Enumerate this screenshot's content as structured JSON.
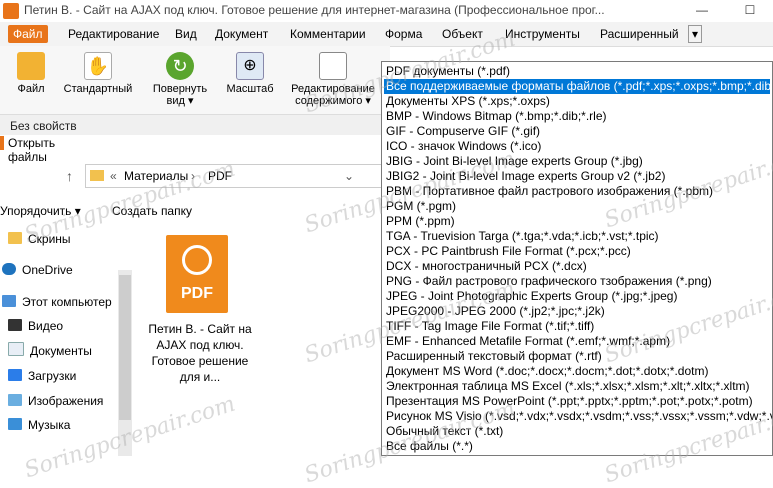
{
  "window": {
    "title": "Петин В. - Сайт на AJAX под ключ. Готовое решение для интернет-магазина (Профессиональное прог...",
    "minimize": "—",
    "maximize": "☐"
  },
  "menu": [
    "Файл",
    "Редактирование",
    "Вид",
    "Документ",
    "Комментарии",
    "Форма",
    "Объект",
    "Инструменты",
    "Расширенный"
  ],
  "menu_more": "▾",
  "ribbon": [
    {
      "line1": "Файл",
      "line2": ""
    },
    {
      "line1": "Стандартный",
      "line2": ""
    },
    {
      "line1": "Повернуть",
      "line2": "вид ▾"
    },
    {
      "line1": "Масштаб",
      "line2": ""
    },
    {
      "line1": "Редактирование",
      "line2": "содержимого ▾"
    }
  ],
  "properties": "Без свойств",
  "dialog": {
    "title": "Открыть файлы",
    "breadcrumb": [
      "«",
      "Материалы",
      "›",
      "PDF"
    ],
    "organize": "Упорядочить ▾",
    "new_folder": "Создать папку",
    "nav": [
      "Скрины",
      "OneDrive",
      "Этот компьютер",
      "Видео",
      "Документы",
      "Загрузки",
      "Изображения",
      "Музыка"
    ],
    "file": {
      "badge": "PDF",
      "name": "Петин В. - Сайт на AJAX под ключ. Готовое решение для и..."
    }
  },
  "filetypes": {
    "selected_index": 1,
    "options": [
      "PDF документы (*.pdf)",
      "Все поддерживаемые форматы файлов (*.pdf;*.xps;*.oxps;*.bmp;*.dib;*",
      "Документы XPS (*.xps;*.oxps)",
      "BMP - Windows Bitmap (*.bmp;*.dib;*.rle)",
      "GIF - Compuserve GIF (*.gif)",
      "ICO - значок Windows (*.ico)",
      "JBIG - Joint Bi-level Image experts Group (*.jbg)",
      "JBIG2 - Joint Bi-level Image experts Group v2 (*.jb2)",
      "PBM - Портативное файл растрового изображения (*.pbm)",
      "PGM (*.pgm)",
      "PPM (*.ppm)",
      "TGA - Truevision Targa (*.tga;*.vda;*.icb;*.vst;*.tpic)",
      "PCX - PC Paintbrush File Format (*.pcx;*.pcc)",
      "DCX - многостраничный PCX (*.dcx)",
      "PNG - Файл растрового графического тзображения (*.png)",
      "JPEG - Joint Photographic Experts Group (*.jpg;*.jpeg)",
      "JPEG2000 - JPEG 2000 (*.jp2;*.jpc;*.j2k)",
      "TIFF - Tag Image File Format (*.tif;*.tiff)",
      "EMF - Enhanced Metafile Format (*.emf;*.wmf;*.apm)",
      "Расширенный текстовый формат (*.rtf)",
      "Документ MS Word (*.doc;*.docx;*.docm;*.dot;*.dotx;*.dotm)",
      "Электронная таблица MS Excel (*.xls;*.xlsx;*.xlsm;*.xlt;*.xltx;*.xltm)",
      "Презентация MS PowerPoint (*.ppt;*.pptx;*.pptm;*.pot;*.potx;*.potm)",
      "Рисунок MS Visio (*.vsd;*.vdx;*.vsdx;*.vsdm;*.vss;*.vssx;*.vssm;*.vdw;*.vst;",
      "Обычный текст (*.txt)",
      "Все файлы (*.*)"
    ]
  },
  "watermark": "Soringpcrepair.com",
  "colors": {
    "accent": "#e8741a",
    "selection": "#0078d7"
  }
}
